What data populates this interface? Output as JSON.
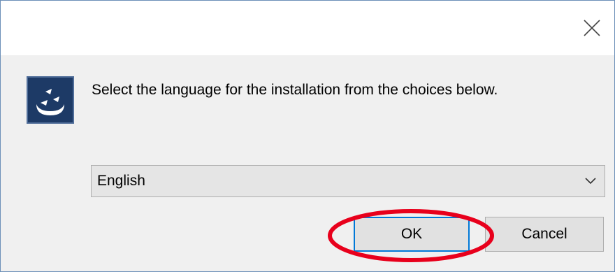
{
  "dialog": {
    "prompt": "Select the language for the installation from the choices below.",
    "icon": "installer-app-icon",
    "close_icon": "close-icon"
  },
  "language_select": {
    "selected": "English",
    "arrow_icon": "chevron-down-icon"
  },
  "buttons": {
    "ok_label": "OK",
    "cancel_label": "Cancel"
  },
  "annotation": {
    "highlight_color": "#e8001c",
    "target": "ok-button"
  },
  "colors": {
    "window_border": "#6b8fb8",
    "client_bg": "#f0f0f0",
    "focus_border": "#0078d7",
    "icon_bg": "#1d3a66"
  }
}
